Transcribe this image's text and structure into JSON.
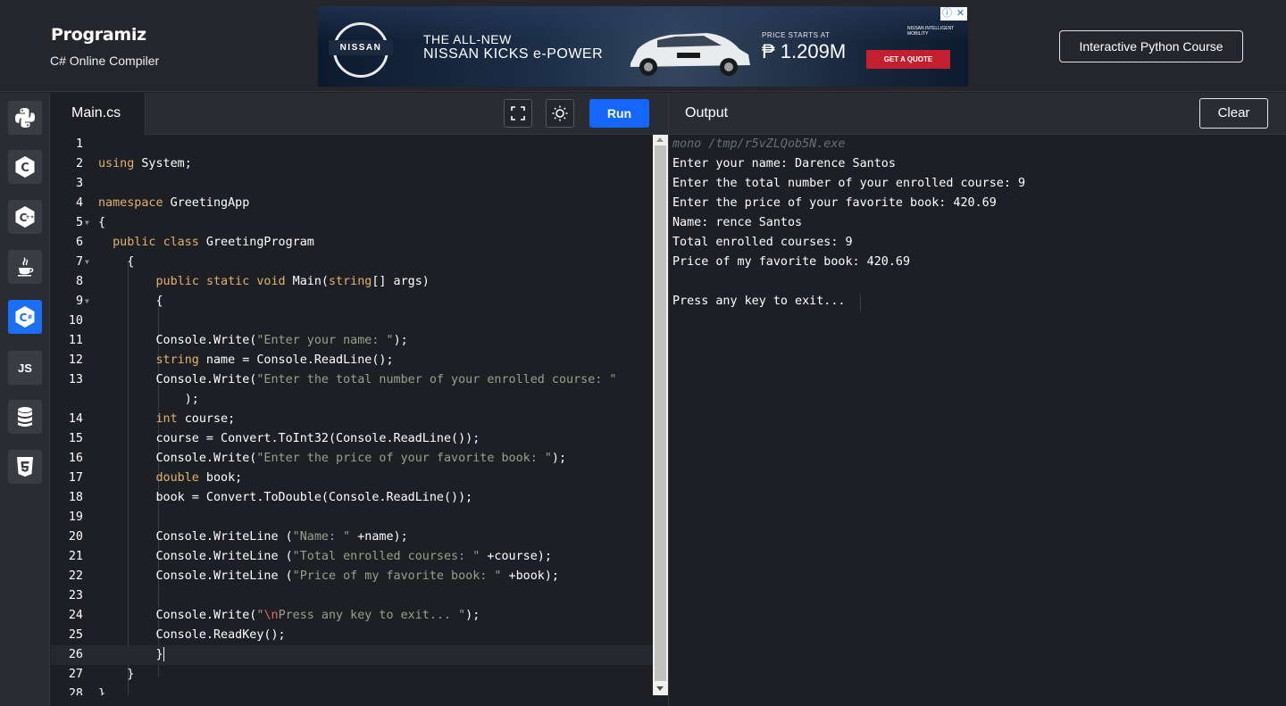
{
  "header": {
    "logo": "Programiz",
    "subtitle": "C# Online Compiler",
    "course_button": "Interactive Python Course"
  },
  "ad": {
    "brand": "NISSAN",
    "headline1": "THE ALL-NEW",
    "headline2": "NISSAN KICKS e-POWER",
    "price_label": "PRICE STARTS AT",
    "price": "₱ 1.209M",
    "cta": "GET A QUOTE",
    "brand_small": "NISSAN INTELLIGENT MOBILITY"
  },
  "sidebar": {
    "languages": [
      {
        "name": "Python",
        "icon": "python-icon"
      },
      {
        "name": "C",
        "icon": "c-icon"
      },
      {
        "name": "C++",
        "icon": "cpp-icon"
      },
      {
        "name": "Java",
        "icon": "java-icon"
      },
      {
        "name": "C#",
        "icon": "csharp-icon",
        "active": true
      },
      {
        "name": "JavaScript",
        "icon": "js-icon",
        "label": "JS"
      },
      {
        "name": "SQL",
        "icon": "database-icon"
      },
      {
        "name": "HTML",
        "icon": "html5-icon"
      }
    ]
  },
  "editor": {
    "file_tab": "Main.cs",
    "run_label": "Run",
    "lines": [
      "1",
      "2",
      "3",
      "4",
      "5",
      "6",
      "7",
      "8",
      "9",
      "10",
      "11",
      "12",
      "13",
      "14",
      "15",
      "16",
      "17",
      "18",
      "19",
      "20",
      "21",
      "22",
      "23",
      "24",
      "25",
      "26",
      "27",
      "28"
    ]
  },
  "output": {
    "title": "Output",
    "clear_label": "Clear",
    "lines": [
      "mono /tmp/r5vZLQob5N.exe",
      "Enter your name: Darence Santos",
      "Enter the total number of your enrolled course: 9",
      "Enter the price of your favorite book: 420.69",
      "Name: rence Santos",
      "Total enrolled courses: 9",
      "Price of my favorite book: 420.69",
      "",
      "Press any key to exit..."
    ]
  },
  "colors": {
    "accent": "#1466ff",
    "keyword": "#e0b36f",
    "string": "#9aa08a",
    "background": "#1d1f25"
  }
}
